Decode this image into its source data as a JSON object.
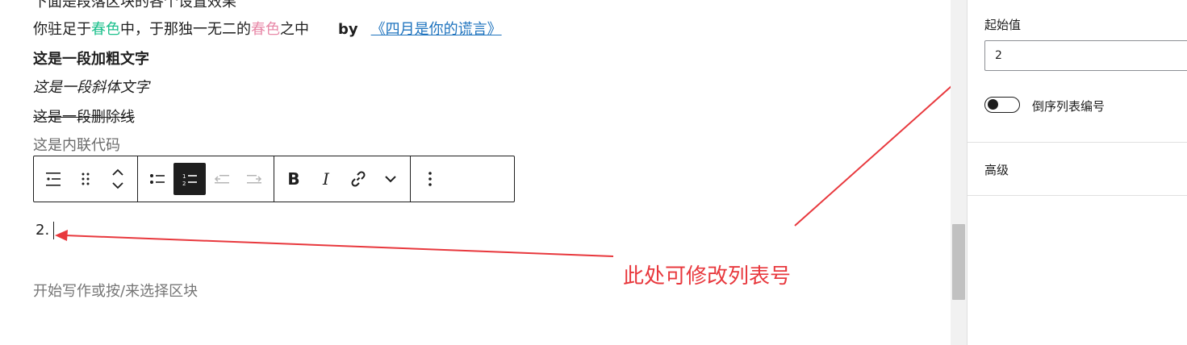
{
  "editor": {
    "top_cut_text": "下面是段落区块的各个设置效果",
    "para1": {
      "pre": "你驻足于",
      "green": "春色",
      "mid": "中，于那独一无二的",
      "pink": "春色",
      "post": "之中",
      "by": "by",
      "link": "《四月是你的谎言》"
    },
    "bold_text": "这是一段加粗文字",
    "italic_text": "这是一段斜体文字",
    "strike_text": "这是一段删除线",
    "code_text": "这是内联代码",
    "list_item_number": "2.",
    "placeholder": "开始写作或按/来选择区块"
  },
  "toolbar": {
    "bold_label": "B",
    "italic_label": "I"
  },
  "annotation": {
    "text": "此处可修改列表号",
    "color": "#e8383d"
  },
  "sidebar": {
    "start_value_label": "起始值",
    "start_value": "2",
    "reverse_label": "倒序列表编号",
    "reverse_on": false,
    "advanced_label": "高级"
  },
  "colors": {
    "spring_green": "#1cc08c",
    "spring_pink": "#e889a8",
    "link_blue": "#1e73be"
  }
}
